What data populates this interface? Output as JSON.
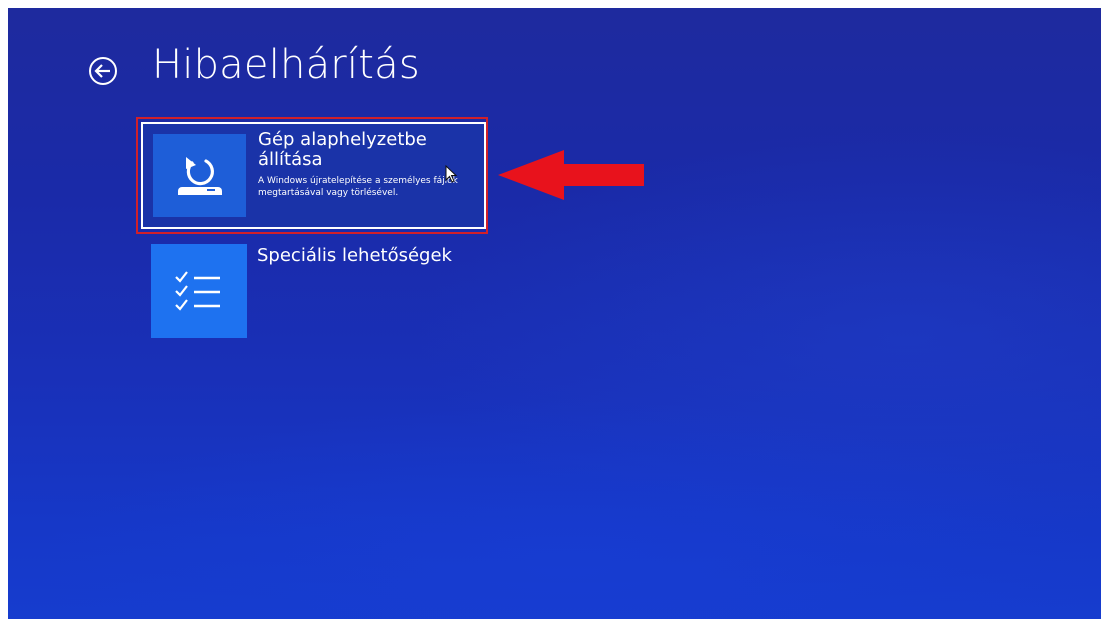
{
  "header": {
    "title": "Hibaelhárítás",
    "back_icon": "back-arrow-circle-icon"
  },
  "tiles": [
    {
      "title": "Gép alaphelyzetbe állítása",
      "description": "A Windows újratelepítése a személyes fájlok megtartásával vagy törlésével.",
      "icon": "reset-pc-icon",
      "selected": true
    },
    {
      "title": "Speciális lehetőségek",
      "icon": "checklist-icon",
      "selected": false
    }
  ],
  "annotation": {
    "arrow_color": "#e8121c",
    "highlight_color": "#d0202a"
  },
  "colors": {
    "background": "#1a2aa8",
    "tile_icon_bg": "#1e72f0",
    "text": "#ffffff"
  }
}
